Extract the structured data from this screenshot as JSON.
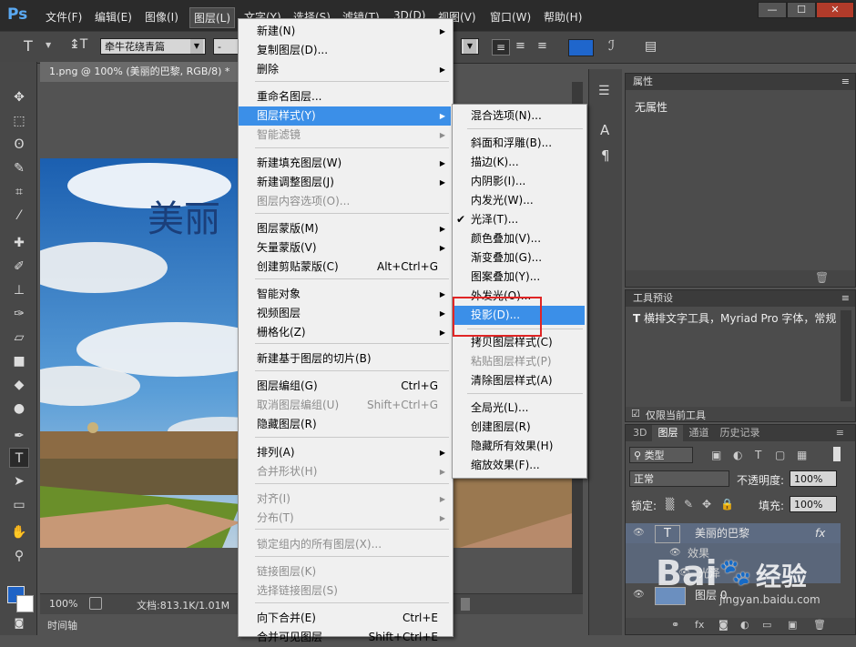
{
  "app": {
    "logo": "Ps",
    "menubar": [
      "文件(F)",
      "编辑(E)",
      "图像(I)",
      "图层(L)",
      "文字(Y)",
      "选择(S)",
      "滤镜(T)",
      "3D(D)",
      "视图(V)",
      "窗口(W)",
      "帮助(H)"
    ],
    "window_buttons": [
      "—",
      "☐",
      "✕"
    ]
  },
  "options": {
    "tool_glyph": "T",
    "font_family": "牵牛花绕青篇",
    "font_style": "-",
    "font_size": "",
    "color_swatch": "#1f66cc"
  },
  "document": {
    "tab_title": "1.png @ 100% (美丽的巴黎, RGB/8) *",
    "canvas_text": "美丽",
    "zoom": "100%",
    "doc_info": "文档:813.1K/1.01M",
    "timeline_label": "时间轴"
  },
  "properties_panel": {
    "title": "属性",
    "content": "无属性"
  },
  "tool_presets_panel": {
    "title": "工具预设",
    "entry": "横排文字工具，Myriad Pro 字体，常规",
    "checkbox_label": "仅限当前工具"
  },
  "layers_panel": {
    "tabs": [
      "3D",
      "图层",
      "通道",
      "历史记录"
    ],
    "filter_kind": "类型",
    "blend_mode": "正常",
    "opacity_label": "不透明度:",
    "opacity_value": "100%",
    "lock_label": "锁定:",
    "fill_label": "填充:",
    "fill_value": "100%",
    "layers": [
      {
        "name": "美丽的巴黎",
        "thumb": "T",
        "fx": "fx"
      },
      {
        "name": "效果"
      },
      {
        "name": "光泽"
      },
      {
        "name": "图层 0"
      }
    ]
  },
  "layer_menu": {
    "items": [
      {
        "label": "新建(N)",
        "shortcut": "",
        "sub": true,
        "disabled": false
      },
      {
        "label": "复制图层(D)...",
        "shortcut": "",
        "sub": false,
        "disabled": false
      },
      {
        "label": "删除",
        "shortcut": "",
        "sub": true,
        "disabled": false
      },
      {
        "label": "重命名图层...",
        "shortcut": "",
        "sub": false,
        "disabled": false
      },
      {
        "label": "图层样式(Y)",
        "shortcut": "",
        "sub": true,
        "disabled": false
      },
      {
        "label": "智能滤镜",
        "shortcut": "",
        "sub": true,
        "disabled": true
      },
      {
        "label": "新建填充图层(W)",
        "shortcut": "",
        "sub": true,
        "disabled": false
      },
      {
        "label": "新建调整图层(J)",
        "shortcut": "",
        "sub": true,
        "disabled": false
      },
      {
        "label": "图层内容选项(O)...",
        "shortcut": "",
        "sub": false,
        "disabled": true
      },
      {
        "label": "图层蒙版(M)",
        "shortcut": "",
        "sub": true,
        "disabled": false
      },
      {
        "label": "矢量蒙版(V)",
        "shortcut": "",
        "sub": true,
        "disabled": false
      },
      {
        "label": "创建剪贴蒙版(C)",
        "shortcut": "Alt+Ctrl+G",
        "sub": false,
        "disabled": false
      },
      {
        "label": "智能对象",
        "shortcut": "",
        "sub": true,
        "disabled": false
      },
      {
        "label": "视频图层",
        "shortcut": "",
        "sub": true,
        "disabled": false
      },
      {
        "label": "栅格化(Z)",
        "shortcut": "",
        "sub": true,
        "disabled": false
      },
      {
        "label": "新建基于图层的切片(B)",
        "shortcut": "",
        "sub": false,
        "disabled": false
      },
      {
        "label": "图层编组(G)",
        "shortcut": "Ctrl+G",
        "sub": false,
        "disabled": false
      },
      {
        "label": "取消图层编组(U)",
        "shortcut": "Shift+Ctrl+G",
        "sub": false,
        "disabled": true
      },
      {
        "label": "隐藏图层(R)",
        "shortcut": "",
        "sub": false,
        "disabled": false
      },
      {
        "label": "排列(A)",
        "shortcut": "",
        "sub": true,
        "disabled": false
      },
      {
        "label": "合并形状(H)",
        "shortcut": "",
        "sub": true,
        "disabled": true
      },
      {
        "label": "对齐(I)",
        "shortcut": "",
        "sub": true,
        "disabled": true
      },
      {
        "label": "分布(T)",
        "shortcut": "",
        "sub": true,
        "disabled": true
      },
      {
        "label": "锁定组内的所有图层(X)...",
        "shortcut": "",
        "sub": false,
        "disabled": true
      },
      {
        "label": "链接图层(K)",
        "shortcut": "",
        "sub": false,
        "disabled": true
      },
      {
        "label": "选择链接图层(S)",
        "shortcut": "",
        "sub": false,
        "disabled": true
      },
      {
        "label": "向下合并(E)",
        "shortcut": "Ctrl+E",
        "sub": false,
        "disabled": false
      },
      {
        "label": "合并可见图层",
        "shortcut": "Shift+Ctrl+E",
        "sub": false,
        "disabled": false
      }
    ]
  },
  "style_menu": {
    "items": [
      {
        "label": "混合选项(N)...",
        "disabled": false,
        "checked": false
      },
      {
        "label": "斜面和浮雕(B)...",
        "disabled": false,
        "checked": false
      },
      {
        "label": "描边(K)...",
        "disabled": false,
        "checked": false
      },
      {
        "label": "内阴影(I)...",
        "disabled": false,
        "checked": false
      },
      {
        "label": "内发光(W)...",
        "disabled": false,
        "checked": false
      },
      {
        "label": "光泽(T)...",
        "disabled": false,
        "checked": true
      },
      {
        "label": "颜色叠加(V)...",
        "disabled": false,
        "checked": false
      },
      {
        "label": "渐变叠加(G)...",
        "disabled": false,
        "checked": false
      },
      {
        "label": "图案叠加(Y)...",
        "disabled": false,
        "checked": false
      },
      {
        "label": "外发光(O)...",
        "disabled": false,
        "checked": false
      },
      {
        "label": "投影(D)...",
        "disabled": false,
        "checked": false
      },
      {
        "label": "拷贝图层样式(C)",
        "disabled": false,
        "checked": false
      },
      {
        "label": "粘贴图层样式(P)",
        "disabled": true,
        "checked": false
      },
      {
        "label": "清除图层样式(A)",
        "disabled": false,
        "checked": false
      },
      {
        "label": "全局光(L)...",
        "disabled": false,
        "checked": false
      },
      {
        "label": "创建图层(R)",
        "disabled": false,
        "checked": false
      },
      {
        "label": "隐藏所有效果(H)",
        "disabled": false,
        "checked": false
      },
      {
        "label": "缩放效果(F)...",
        "disabled": false,
        "checked": false
      }
    ]
  },
  "watermark": {
    "logo": "Bai",
    "cn": "经验",
    "url": "jingyan.baidu.com"
  }
}
